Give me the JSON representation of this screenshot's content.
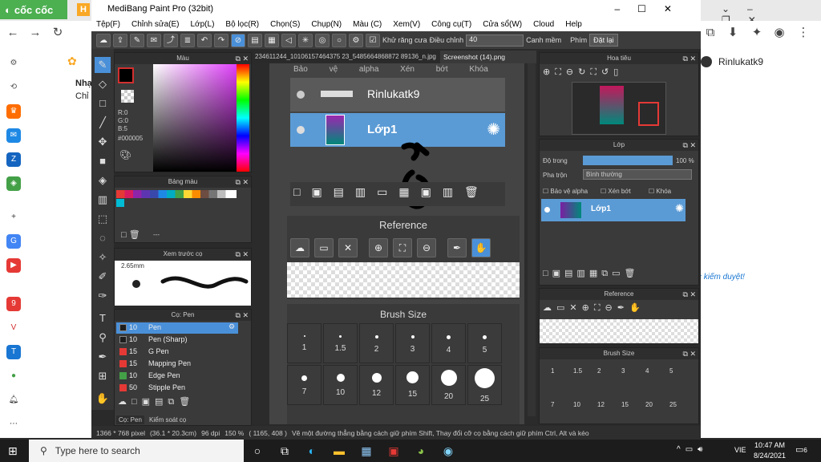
{
  "browser": {
    "brand_label": "cốc cốc",
    "right_user": "Rinlukatk9",
    "right_link": "c kiếm duyệt!",
    "page_text_1": "Nhạ",
    "page_text_2": "Chỉ"
  },
  "app": {
    "title": "MediBang Paint Pro (32bit)",
    "menu": [
      "Tệp(F)",
      "Chỉnh sửa(E)",
      "Lớp(L)",
      "Bộ lọc(R)",
      "Chọn(S)",
      "Chụp(N)",
      "Màu (C)",
      "Xem(V)",
      "Công cụ(T)",
      "Cửa sổ(W)",
      "Cloud",
      "Help"
    ],
    "toolbar": {
      "antialias_label": "Khử răng cưa",
      "correction_label": "Điều chỉnh",
      "correction_value": "40",
      "snap_label": "Canh mềm",
      "key_label": "Phím",
      "reset_label": "Đặt lại"
    },
    "tabs": [
      "234611244_10106157464375 23_5485664868872 89136_n.jpg",
      "Screenshot (14).png"
    ],
    "color_panel": {
      "title": "Màu",
      "r": "R:0",
      "g": "G:0",
      "b": "B:5",
      "hex": "#000005"
    },
    "palette_panel": {
      "title": "Bảng màu",
      "dots": "---"
    },
    "brush_preview": {
      "title": "Xem trước cọ",
      "size": "2.65mm"
    },
    "brush_panel": {
      "title": "Cọ: Pen",
      "brushes": [
        {
          "size": "10",
          "name": "Pen",
          "color": "#1e1e1e"
        },
        {
          "size": "10",
          "name": "Pen (Sharp)",
          "color": "#1e1e1e"
        },
        {
          "size": "15",
          "name": "G Pen",
          "color": "#e53935"
        },
        {
          "size": "15",
          "name": "Mapping Pen",
          "color": "#e53935"
        },
        {
          "size": "10",
          "name": "Edge Pen",
          "color": "#43a047"
        },
        {
          "size": "50",
          "name": "Stipple Pen",
          "color": "#e53935"
        }
      ],
      "tab1": "Cọ: Pen",
      "tab2": "Kiểm soát cọ"
    },
    "canvas_layers": {
      "header_labels": [
        "Bảo vệ alpha",
        "Xén bớt",
        "Khóa"
      ],
      "layer_top": "Rinlukatk9",
      "layer_main": "Lớp1"
    },
    "reference_panel": {
      "title": "Reference"
    },
    "brush_size_panel": {
      "title": "Brush Size",
      "sizes_row1": [
        "1",
        "1.5",
        "2",
        "3",
        "4",
        "5"
      ],
      "sizes_row2": [
        "7",
        "10",
        "12",
        "15",
        "20",
        "25"
      ]
    },
    "navigator": {
      "title": "Hoa tiêu"
    },
    "layer_panel": {
      "title": "Lớp",
      "opacity_label": "Độ trong",
      "opacity_value": "100 %",
      "opacity_fraction": 1.0,
      "blend_label": "Pha trộn",
      "blend_value": "Bình thường",
      "alpha_label": "Bảo vệ alpha",
      "clip_label": "Xén bớt",
      "lock_label": "Khóa",
      "layer_name": "Lớp1"
    },
    "status": {
      "pixels": "1366 * 768 pixel",
      "cm": "(36.1 * 20.3cm)",
      "dpi": "96 dpi",
      "zoom": "150 %",
      "coords": "( 1165, 408 )",
      "hint": "Vẽ một đường thẳng bằng cách giữ phím Shift, Thay đổi cỡ cọ bằng cách giữ phím Ctrl, Alt và kéo"
    }
  },
  "taskbar": {
    "search_placeholder": "Type here to search",
    "lang": "VIE",
    "time": "10:47 AM",
    "date": "8/24/2021",
    "notifications": "6"
  },
  "colors": {
    "accent_blue": "#4a90d9",
    "active_layer": "#5b9bd5",
    "cococ_green": "#4caf50"
  }
}
